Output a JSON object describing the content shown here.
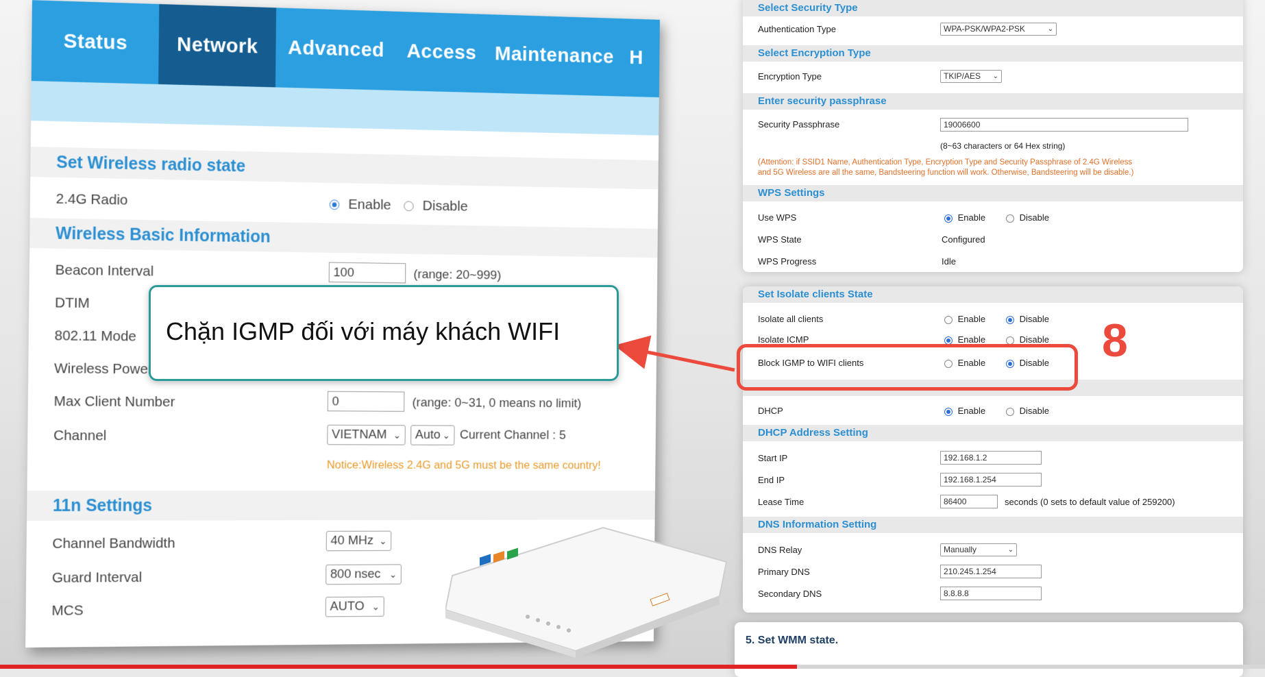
{
  "left": {
    "tabs": [
      "Status",
      "Network",
      "Advanced",
      "Access",
      "Maintenance",
      "H"
    ],
    "active_tab": "Network",
    "sections": {
      "radio_state": "Set Wireless radio state",
      "basic_info": "Wireless Basic Information",
      "n11": "11n Settings"
    },
    "radio_24g": {
      "label": "2.4G Radio",
      "enable": "Enable",
      "disable": "Disable"
    },
    "beacon": {
      "label": "Beacon Interval",
      "value": "100",
      "hint": "(range: 20~999)"
    },
    "dtim": {
      "label": "DTIM"
    },
    "mode": {
      "label": "802.11 Mode"
    },
    "power": {
      "label": "Wireless Power"
    },
    "max_client": {
      "label": "Max Client Number",
      "value": "0",
      "hint": "(range: 0~31, 0 means no limit)"
    },
    "channel": {
      "label": "Channel",
      "country": "VIETNAM",
      "mode": "Auto",
      "current": "Current Channel : 5"
    },
    "notice": "Notice:Wireless 2.4G and 5G must be the same country!",
    "bandwidth": {
      "label": "Channel Bandwidth",
      "value": "40 MHz"
    },
    "guard": {
      "label": "Guard Interval",
      "value": "800 nsec"
    },
    "mcs": {
      "label": "MCS",
      "value": "AUTO"
    }
  },
  "right_top": {
    "sec_security": "Select Security Type",
    "auth_label": "Authentication Type",
    "auth_value": "WPA-PSK/WPA2-PSK",
    "sec_encryption": "Select Encryption Type",
    "enc_label": "Encryption Type",
    "enc_value": "TKIP/AES",
    "sec_pass": "Enter security passphrase",
    "pass_label": "Security Passphrase",
    "pass_value": "19006600",
    "pass_hint": "(8~63 characters or 64 Hex string)",
    "attention_1": "(Attention: if SSID1 Name, Authentication Type, Encryption Type and Security Passphrase of 2.4G Wireless",
    "attention_2": "and 5G Wireless are all the same, Bandsteering function will work. Otherwise, Bandsteering will be disable.)",
    "sec_wps": "WPS Settings",
    "use_wps": "Use WPS",
    "wps_state_label": "WPS State",
    "wps_state_value": "Configured",
    "wps_progress_label": "WPS Progress",
    "wps_progress_value": "Idle",
    "enable": "Enable",
    "disable": "Disable"
  },
  "right_mid": {
    "sec_isolate": "Set Isolate clients State",
    "isolate_all": "Isolate all clients",
    "isolate_icmp": "Isolate ICMP",
    "block_igmp": "Block IGMP to WIFI clients",
    "dhcp_label": "DHCP",
    "sec_dhcp_addr": "DHCP Address Setting",
    "start_ip_label": "Start IP",
    "start_ip": "192.168.1.2",
    "end_ip_label": "End IP",
    "end_ip": "192.168.1.254",
    "lease_label": "Lease Time",
    "lease_value": "86400",
    "lease_hint": "seconds (0 sets to default value of 259200)",
    "sec_dns": "DNS Information Setting",
    "dns_relay_label": "DNS Relay",
    "dns_relay_value": "Manually",
    "primary_dns_label": "Primary DNS",
    "primary_dns": "210.245.1.254",
    "secondary_dns_label": "Secondary DNS",
    "secondary_dns": "8.8.8.8",
    "enable": "Enable",
    "disable": "Disable"
  },
  "right_bottom": {
    "title": "5. Set WMM state."
  },
  "callout": {
    "text": "Chặn IGMP đối với máy khách WIFI",
    "step": "8"
  },
  "video_progress": 0.63,
  "colors": {
    "nav_blue": "#2b9fe0",
    "nav_active": "#155d90",
    "section_blue": "#2b8fd1",
    "highlight_red": "#ec4a3c",
    "callout_border": "#2a9b98"
  }
}
